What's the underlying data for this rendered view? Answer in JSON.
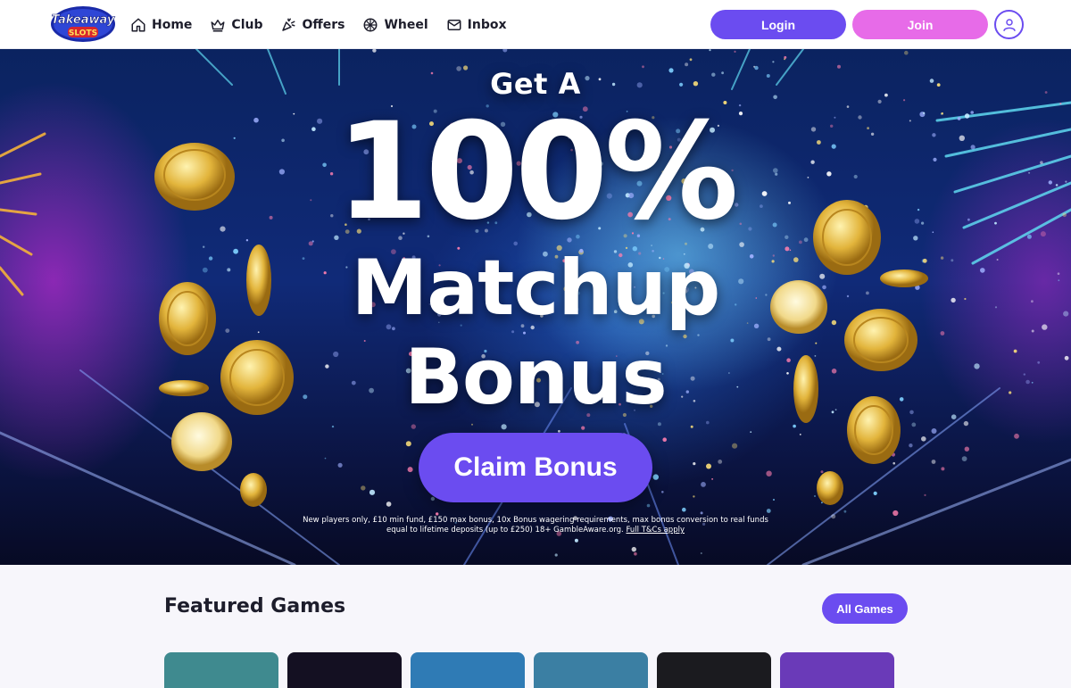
{
  "brand": {
    "logo_text_top": "Takeaway",
    "logo_text_bottom": "SLOTS"
  },
  "nav": {
    "items": [
      {
        "label": "Home",
        "icon": "home-icon"
      },
      {
        "label": "Club",
        "icon": "crown-icon"
      },
      {
        "label": "Offers",
        "icon": "party-popper-icon"
      },
      {
        "label": "Wheel",
        "icon": "wheel-icon"
      },
      {
        "label": "Inbox",
        "icon": "mail-icon"
      }
    ]
  },
  "header": {
    "login_label": "Login",
    "join_label": "Join",
    "profile_icon": "user-icon"
  },
  "colors": {
    "accent": "#6b4cf0",
    "join": "#e76be8",
    "text_dark": "#1d1d2b"
  },
  "hero": {
    "line1": "Get A",
    "line2": "100%",
    "line3": "Matchup",
    "line4": "Bonus",
    "cta_label": "Claim Bonus",
    "terms_line1": "New players only, £10 min fund, £150 max bonus, 10x Bonus wagering requirements, max bonus conversion to real funds",
    "terms_line2": "equal to lifetime deposits (up to £250) 18+ GambleAware.org.",
    "terms_link": "Full T&Cs apply"
  },
  "featured": {
    "title": "Featured Games",
    "all_games_label": "All Games",
    "thumb_colors": [
      "#3f8a8f",
      "#141022",
      "#2f7bb5",
      "#3b7fa3",
      "#1b1b1f",
      "#6a3ab8"
    ]
  }
}
